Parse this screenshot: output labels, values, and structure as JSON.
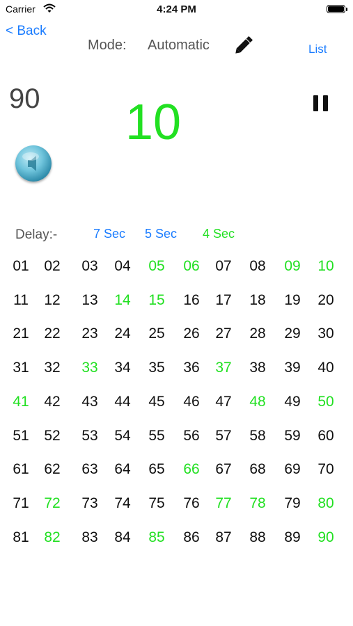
{
  "status_bar": {
    "carrier": "Carrier",
    "time": "4:24 PM"
  },
  "nav": {
    "back": "< Back",
    "mode_label": "Mode:",
    "mode_value": "Automatic",
    "list": "List"
  },
  "display": {
    "count": "90",
    "current": "10"
  },
  "delay": {
    "label": "Delay:-",
    "options": [
      {
        "label": "7 Sec",
        "color": "#1a7cff"
      },
      {
        "label": "5 Sec",
        "color": "#1a7cff"
      },
      {
        "label": "4 Sec",
        "color": "#22e022"
      }
    ]
  },
  "colors": {
    "called": "#22e022",
    "normal": "#111111",
    "accent": "#1a7cff"
  },
  "board": {
    "numbers": [
      "01",
      "02",
      "03",
      "04",
      "05",
      "06",
      "07",
      "08",
      "09",
      "10",
      "11",
      "12",
      "13",
      "14",
      "15",
      "16",
      "17",
      "18",
      "19",
      "20",
      "21",
      "22",
      "23",
      "24",
      "25",
      "26",
      "27",
      "28",
      "29",
      "30",
      "31",
      "32",
      "33",
      "34",
      "35",
      "36",
      "37",
      "38",
      "39",
      "40",
      "41",
      "42",
      "43",
      "44",
      "45",
      "46",
      "47",
      "48",
      "49",
      "50",
      "51",
      "52",
      "53",
      "54",
      "55",
      "56",
      "57",
      "58",
      "59",
      "60",
      "61",
      "62",
      "63",
      "64",
      "65",
      "66",
      "67",
      "68",
      "69",
      "70",
      "71",
      "72",
      "73",
      "74",
      "75",
      "76",
      "77",
      "78",
      "79",
      "80",
      "81",
      "82",
      "83",
      "84",
      "85",
      "86",
      "87",
      "88",
      "89",
      "90"
    ],
    "called": [
      "05",
      "06",
      "09",
      "10",
      "14",
      "15",
      "33",
      "37",
      "41",
      "48",
      "50",
      "66",
      "72",
      "77",
      "78",
      "80",
      "82",
      "85",
      "90"
    ]
  }
}
